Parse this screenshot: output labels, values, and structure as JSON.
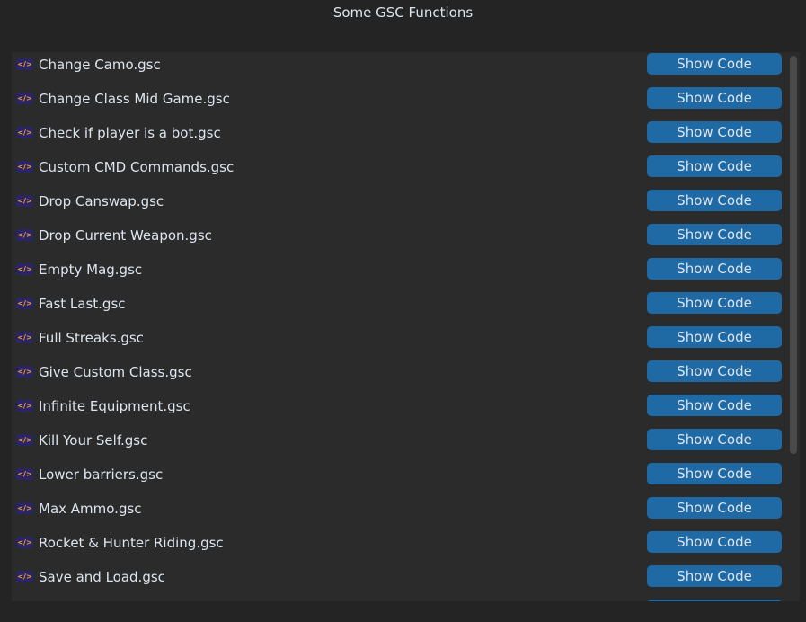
{
  "window": {
    "title": "Some GSC Functions"
  },
  "button_label": "Show Code",
  "colors": {
    "button": "#1f6aa5",
    "panel": "#2b2b2b",
    "background": "#242424"
  },
  "items": [
    {
      "label": "Change Camo.gsc",
      "icon": "code-file-icon"
    },
    {
      "label": "Change Class Mid Game.gsc",
      "icon": "code-file-icon"
    },
    {
      "label": "Check if player is a bot.gsc",
      "icon": "code-file-icon"
    },
    {
      "label": "Custom CMD Commands.gsc",
      "icon": "code-file-icon"
    },
    {
      "label": "Drop Canswap.gsc",
      "icon": "code-file-icon"
    },
    {
      "label": "Drop Current Weapon.gsc",
      "icon": "code-file-icon"
    },
    {
      "label": "Empty Mag.gsc",
      "icon": "code-file-icon"
    },
    {
      "label": "Fast Last.gsc",
      "icon": "code-file-icon"
    },
    {
      "label": "Full Streaks.gsc",
      "icon": "code-file-icon"
    },
    {
      "label": "Give Custom Class.gsc",
      "icon": "code-file-icon"
    },
    {
      "label": "Infinite Equipment.gsc",
      "icon": "code-file-icon"
    },
    {
      "label": "Kill Your Self.gsc",
      "icon": "code-file-icon"
    },
    {
      "label": "Lower barriers.gsc",
      "icon": "code-file-icon"
    },
    {
      "label": "Max Ammo.gsc",
      "icon": "code-file-icon"
    },
    {
      "label": "Rocket & Hunter Riding.gsc",
      "icon": "code-file-icon"
    },
    {
      "label": "Save and Load.gsc",
      "icon": "code-file-icon"
    },
    {
      "label": "",
      "icon": ""
    }
  ]
}
